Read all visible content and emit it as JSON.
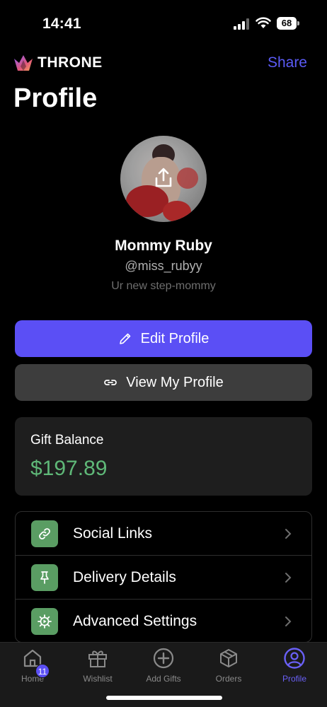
{
  "status_bar": {
    "time": "14:41",
    "battery": "68"
  },
  "header": {
    "brand": "THRONE",
    "share_label": "Share"
  },
  "page": {
    "title": "Profile"
  },
  "profile": {
    "name": "Mommy Ruby",
    "handle": "@miss_rubyy",
    "bio": "Ur new step-mommy"
  },
  "actions": {
    "edit_label": "Edit Profile",
    "view_label": "View My Profile"
  },
  "gift_balance": {
    "label": "Gift Balance",
    "amount": "$197.89"
  },
  "settings": [
    {
      "label": "Social Links",
      "icon": "link-icon"
    },
    {
      "label": "Delivery Details",
      "icon": "pin-icon"
    },
    {
      "label": "Advanced Settings",
      "icon": "gear-icon"
    }
  ],
  "tabs": [
    {
      "label": "Home",
      "icon": "home-icon",
      "badge": "11"
    },
    {
      "label": "Wishlist",
      "icon": "gift-icon"
    },
    {
      "label": "Add Gifts",
      "icon": "plus-circle-icon"
    },
    {
      "label": "Orders",
      "icon": "box-icon"
    },
    {
      "label": "Profile",
      "icon": "user-icon",
      "active": true
    }
  ],
  "colors": {
    "accent": "#5b4ff5",
    "balance": "#5fb878",
    "settings_icon_bg": "#5a9d63"
  }
}
